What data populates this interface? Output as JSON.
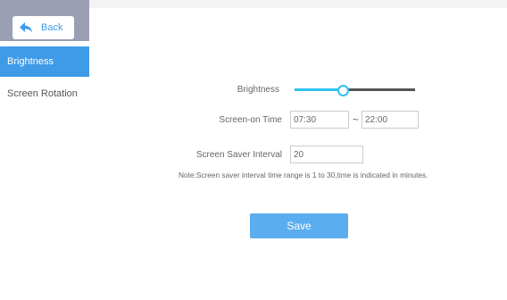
{
  "sidebar": {
    "back_label": "Back",
    "items": [
      {
        "label": "Brightness"
      },
      {
        "label": "Screen Rotation"
      }
    ]
  },
  "settings": {
    "brightness_label": "Brightness",
    "brightness_level": 0.4,
    "screen_on_time_label": "Screen-on Time",
    "screen_on_start": "07:30",
    "time_separator": "~",
    "screen_on_end": "22:00",
    "screen_saver_label": "Screen Saver Interval",
    "screen_saver_value": "20",
    "note": "Note:Screen saver interval time range is 1 to 30,time is indicated in minutes.",
    "save_label": "Save"
  },
  "colors": {
    "accent": "#3f9be8",
    "slider_active": "#2ec3ee",
    "header_bg": "#9a9fb4",
    "save_button": "#5aaef0"
  },
  "icons": {
    "back": "reply-arrow-icon"
  }
}
